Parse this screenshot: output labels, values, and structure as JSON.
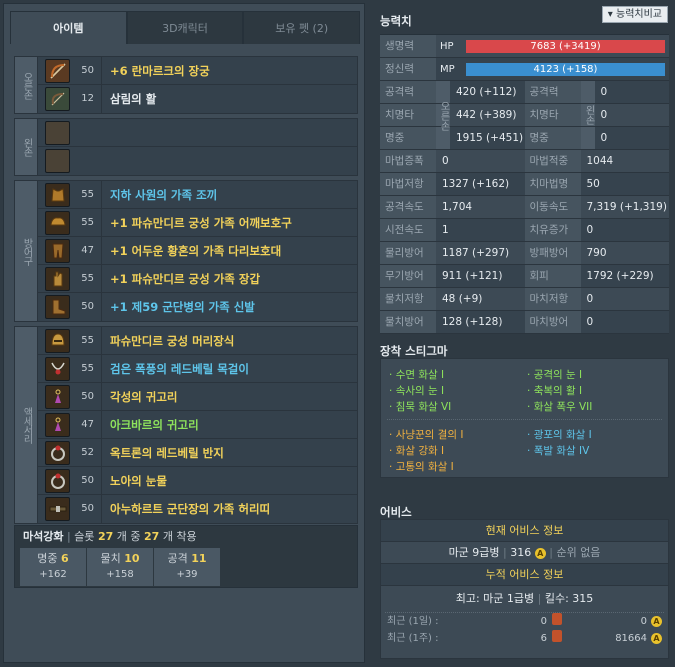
{
  "tabs": [
    "아이템",
    "3D캐릭터",
    "보유 펫 (2)"
  ],
  "groups": {
    "right_hand": "오른손",
    "left_hand": "왼손",
    "armor": "방어구",
    "accessory": "액세서리"
  },
  "items": {
    "weapon": [
      {
        "level": "50",
        "name": "+6 란마르크의 장궁",
        "color": "#f2d25a",
        "icon": "longbow-icon"
      },
      {
        "level": "12",
        "name": "삼림의 활",
        "color": "#e6ebef",
        "icon": "bow-icon"
      }
    ],
    "armor": [
      {
        "level": "55",
        "name": "지하 사원의 가족 조끼",
        "color": "#5ec5ea",
        "icon": "vest-icon"
      },
      {
        "level": "55",
        "name": "+1 파슈만디르 궁성 가족 어깨보호구",
        "color": "#f2d25a",
        "icon": "shoulder-guard-icon"
      },
      {
        "level": "47",
        "name": "+1 어두운 황혼의 가족 다리보호대",
        "color": "#f2d25a",
        "icon": "leg-guard-icon"
      },
      {
        "level": "55",
        "name": "+1 파슈만디르 궁성 가족 장갑",
        "color": "#f2d25a",
        "icon": "glove-icon"
      },
      {
        "level": "50",
        "name": "+1 제59 군단병의 가족 신발",
        "color": "#5ec5ea",
        "icon": "boots-icon"
      }
    ],
    "accessory": [
      {
        "level": "55",
        "name": "파슈만디르 궁성 머리장식",
        "color": "#f2d25a",
        "icon": "helmet-icon"
      },
      {
        "level": "55",
        "name": "검은 폭풍의 레드베릴 목걸이",
        "color": "#5ec5ea",
        "icon": "necklace-icon"
      },
      {
        "level": "50",
        "name": "각성의 귀고리",
        "color": "#f2d25a",
        "icon": "earring-icon"
      },
      {
        "level": "47",
        "name": "아크바르의 귀고리",
        "color": "#8ee35c",
        "icon": "earring-icon"
      },
      {
        "level": "52",
        "name": "옥트론의 레드베릴 반지",
        "color": "#f2d25a",
        "icon": "ring-icon"
      },
      {
        "level": "50",
        "name": "노아의 눈물",
        "color": "#f2d25a",
        "icon": "ring-icon"
      },
      {
        "level": "50",
        "name": "아누하르트 군단장의 가족 허리띠",
        "color": "#f2d25a",
        "icon": "belt-icon"
      }
    ]
  },
  "manastone": {
    "title": "마석강화",
    "slot_label": "슬롯",
    "slot_count": "27",
    "unit": "개 중",
    "equipped": "27",
    "equipped_label": "개 착용",
    "boxes": [
      {
        "name": "명중",
        "value": "6",
        "bonus": "+162"
      },
      {
        "name": "물치",
        "value": "10",
        "bonus": "+158"
      },
      {
        "name": "공격",
        "value": "11",
        "bonus": "+39"
      }
    ]
  },
  "stats": {
    "title": "능력치",
    "compare_button": "능력치비교",
    "hp_label": "생명력",
    "hp_tag": "HP",
    "hp_value": "7683 (+3419)",
    "hp_color": "#d9484b",
    "mp_label": "정신력",
    "mp_tag": "MP",
    "mp_value": "4123 (+158)",
    "mp_color": "#3a8fd0",
    "right_hand_tag": "오른손",
    "left_hand_tag": "왼손",
    "paired": [
      {
        "k1": "공격력",
        "v1": "420 (+112)",
        "k2": "공격력",
        "v2": "0"
      },
      {
        "k1": "치명타",
        "v1": "442 (+389)",
        "k2": "치명타",
        "v2": "0"
      },
      {
        "k1": "명중",
        "v1": "1915 (+451)",
        "k2": "명중",
        "v2": "0"
      }
    ],
    "rows": [
      {
        "k1": "마법증폭",
        "v1": "0",
        "k2": "마법적중",
        "v2": "1044"
      },
      {
        "k1": "마법저항",
        "v1": "1327 (+162)",
        "k2": "치마법명",
        "v2": "50"
      },
      {
        "k1": "공격속도",
        "v1": "1,704",
        "k2": "이동속도",
        "v2": "7,319 (+1,319)"
      },
      {
        "k1": "시전속도",
        "v1": "1",
        "k2": "치유증가",
        "v2": "0"
      },
      {
        "k1": "물리방어",
        "v1": "1187 (+297)",
        "k2": "방패방어",
        "v2": "790"
      },
      {
        "k1": "무기방어",
        "v1": "911 (+121)",
        "k2": "회피",
        "v2": "1792 (+229)"
      },
      {
        "k1": "물치저항",
        "v1": "48 (+9)",
        "k2": "마치저항",
        "v2": "0"
      },
      {
        "k1": "물치방어",
        "v1": "128 (+128)",
        "k2": "마치방어",
        "v2": "0"
      }
    ]
  },
  "stigma": {
    "title": "장착 스티그마",
    "col1": [
      "수면 화살 I",
      "속사의 눈 I",
      "침묵 화살 VI"
    ],
    "col2": [
      "공격의 눈 I",
      "축복의 활 I",
      "화살 폭우 VII"
    ],
    "col3": [
      "사냥꾼의 결의 I",
      "화살 강화 I",
      "고통의 화살 I"
    ],
    "col4": [
      "광포의 화살 I",
      "폭발 화살 IV"
    ]
  },
  "abyss": {
    "title": "어비스",
    "current_header": "현재 어비스 정보",
    "rank": "마군 9급병",
    "points": "316",
    "rank_order": "순위 없음",
    "cumulative_header": "누적 어비스 정보",
    "highest_label": "최고:",
    "highest": "마군 1급병",
    "kills_label": "킬수:",
    "kills": "315",
    "recent": [
      {
        "label": "최근 (1일) :",
        "kills": "0",
        "points": "0"
      },
      {
        "label": "최근 (1주) :",
        "kills": "6",
        "points": "81664"
      }
    ]
  }
}
